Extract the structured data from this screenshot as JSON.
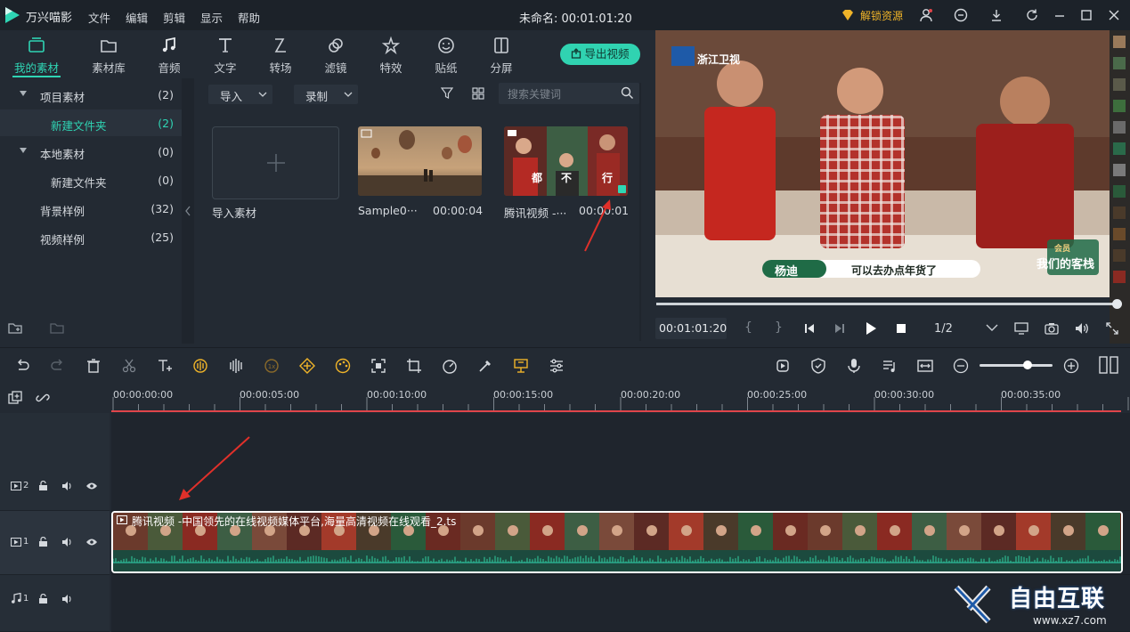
{
  "app": {
    "name": "万兴喵影",
    "doc_title": "未命名: 00:01:01:20",
    "unlock_label": "解锁资源"
  },
  "menu": [
    "文件",
    "编辑",
    "剪辑",
    "显示",
    "帮助"
  ],
  "tools": [
    {
      "label": "我的素材",
      "icon": "folder-media-icon",
      "active": true
    },
    {
      "label": "素材库",
      "icon": "folder-icon"
    },
    {
      "label": "音频",
      "icon": "music-note-icon"
    },
    {
      "label": "文字",
      "icon": "text-icon"
    },
    {
      "label": "转场",
      "icon": "transition-icon"
    },
    {
      "label": "滤镜",
      "icon": "filter-icon"
    },
    {
      "label": "特效",
      "icon": "effects-icon"
    },
    {
      "label": "贴纸",
      "icon": "sticker-icon"
    },
    {
      "label": "分屏",
      "icon": "split-screen-icon"
    }
  ],
  "export_label": "导出视频",
  "tree": [
    {
      "label": "项目素材",
      "count": "(2)",
      "expanded": true
    },
    {
      "label": "新建文件夹",
      "count": "(2)",
      "selected": true
    },
    {
      "label": "本地素材",
      "count": "(0)",
      "expanded": true
    },
    {
      "label": "新建文件夹",
      "count": "(0)"
    },
    {
      "label": "背景样例",
      "count": "(32)"
    },
    {
      "label": "视频样例",
      "count": "(25)"
    }
  ],
  "media_toolbar": {
    "import_label": "导入",
    "record_label": "录制",
    "search_placeholder": "搜索关键词"
  },
  "media_items": [
    {
      "label": "导入素材"
    },
    {
      "name": "Sample0···",
      "duration": "00:00:04"
    },
    {
      "name": "腾讯视频 -···",
      "duration": "00:00:01"
    }
  ],
  "preview": {
    "channel_logo": "浙江卫视",
    "caption_name": "杨迪",
    "caption_text": "可以去办点年货了",
    "show_logo": "我们的客栈",
    "badge": "会员",
    "chars": [
      "都",
      "不",
      "行"
    ],
    "progress": 1.0,
    "timecode": "00:01:01:20",
    "page_ratio": "1/2"
  },
  "timeline": {
    "ticks": [
      "00:00:00:00",
      "00:00:05:00",
      "00:00:10:00",
      "00:00:15:00",
      "00:00:20:00",
      "00:00:25:00",
      "00:00:30:00",
      "00:00:35:00"
    ],
    "tracks": [
      {
        "num": "2",
        "type": "video"
      },
      {
        "num": "1",
        "type": "video"
      },
      {
        "num": "1",
        "type": "audio"
      }
    ],
    "clip_title": "腾讯视频 -中国领先的在线视频媒体平台,海量高清视频在线观看_2.ts"
  },
  "watermark": {
    "main": "自由互联",
    "url": "www.xz7.com"
  },
  "colors": {
    "accent": "#2fd5b4",
    "unlock": "#f0b429",
    "ruler_line": "#e0454a",
    "arrow": "#e0302a"
  }
}
